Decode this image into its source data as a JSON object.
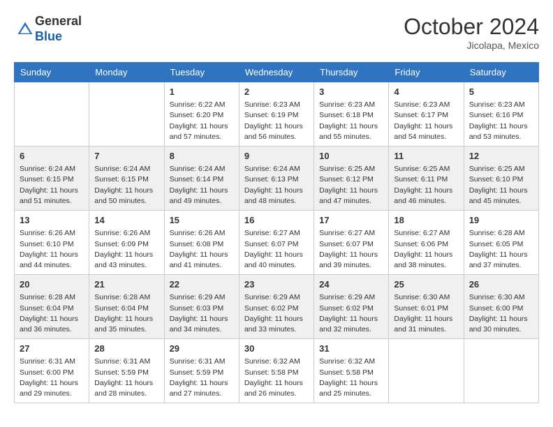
{
  "header": {
    "logo": {
      "line1": "General",
      "line2": "Blue"
    },
    "month": "October 2024",
    "location": "Jicolapa, Mexico"
  },
  "weekdays": [
    "Sunday",
    "Monday",
    "Tuesday",
    "Wednesday",
    "Thursday",
    "Friday",
    "Saturday"
  ],
  "weeks": [
    [
      {
        "day": "",
        "info": ""
      },
      {
        "day": "",
        "info": ""
      },
      {
        "day": "1",
        "info": "Sunrise: 6:22 AM\nSunset: 6:20 PM\nDaylight: 11 hours and 57 minutes."
      },
      {
        "day": "2",
        "info": "Sunrise: 6:23 AM\nSunset: 6:19 PM\nDaylight: 11 hours and 56 minutes."
      },
      {
        "day": "3",
        "info": "Sunrise: 6:23 AM\nSunset: 6:18 PM\nDaylight: 11 hours and 55 minutes."
      },
      {
        "day": "4",
        "info": "Sunrise: 6:23 AM\nSunset: 6:17 PM\nDaylight: 11 hours and 54 minutes."
      },
      {
        "day": "5",
        "info": "Sunrise: 6:23 AM\nSunset: 6:16 PM\nDaylight: 11 hours and 53 minutes."
      }
    ],
    [
      {
        "day": "6",
        "info": "Sunrise: 6:24 AM\nSunset: 6:15 PM\nDaylight: 11 hours and 51 minutes."
      },
      {
        "day": "7",
        "info": "Sunrise: 6:24 AM\nSunset: 6:15 PM\nDaylight: 11 hours and 50 minutes."
      },
      {
        "day": "8",
        "info": "Sunrise: 6:24 AM\nSunset: 6:14 PM\nDaylight: 11 hours and 49 minutes."
      },
      {
        "day": "9",
        "info": "Sunrise: 6:24 AM\nSunset: 6:13 PM\nDaylight: 11 hours and 48 minutes."
      },
      {
        "day": "10",
        "info": "Sunrise: 6:25 AM\nSunset: 6:12 PM\nDaylight: 11 hours and 47 minutes."
      },
      {
        "day": "11",
        "info": "Sunrise: 6:25 AM\nSunset: 6:11 PM\nDaylight: 11 hours and 46 minutes."
      },
      {
        "day": "12",
        "info": "Sunrise: 6:25 AM\nSunset: 6:10 PM\nDaylight: 11 hours and 45 minutes."
      }
    ],
    [
      {
        "day": "13",
        "info": "Sunrise: 6:26 AM\nSunset: 6:10 PM\nDaylight: 11 hours and 44 minutes."
      },
      {
        "day": "14",
        "info": "Sunrise: 6:26 AM\nSunset: 6:09 PM\nDaylight: 11 hours and 43 minutes."
      },
      {
        "day": "15",
        "info": "Sunrise: 6:26 AM\nSunset: 6:08 PM\nDaylight: 11 hours and 41 minutes."
      },
      {
        "day": "16",
        "info": "Sunrise: 6:27 AM\nSunset: 6:07 PM\nDaylight: 11 hours and 40 minutes."
      },
      {
        "day": "17",
        "info": "Sunrise: 6:27 AM\nSunset: 6:07 PM\nDaylight: 11 hours and 39 minutes."
      },
      {
        "day": "18",
        "info": "Sunrise: 6:27 AM\nSunset: 6:06 PM\nDaylight: 11 hours and 38 minutes."
      },
      {
        "day": "19",
        "info": "Sunrise: 6:28 AM\nSunset: 6:05 PM\nDaylight: 11 hours and 37 minutes."
      }
    ],
    [
      {
        "day": "20",
        "info": "Sunrise: 6:28 AM\nSunset: 6:04 PM\nDaylight: 11 hours and 36 minutes."
      },
      {
        "day": "21",
        "info": "Sunrise: 6:28 AM\nSunset: 6:04 PM\nDaylight: 11 hours and 35 minutes."
      },
      {
        "day": "22",
        "info": "Sunrise: 6:29 AM\nSunset: 6:03 PM\nDaylight: 11 hours and 34 minutes."
      },
      {
        "day": "23",
        "info": "Sunrise: 6:29 AM\nSunset: 6:02 PM\nDaylight: 11 hours and 33 minutes."
      },
      {
        "day": "24",
        "info": "Sunrise: 6:29 AM\nSunset: 6:02 PM\nDaylight: 11 hours and 32 minutes."
      },
      {
        "day": "25",
        "info": "Sunrise: 6:30 AM\nSunset: 6:01 PM\nDaylight: 11 hours and 31 minutes."
      },
      {
        "day": "26",
        "info": "Sunrise: 6:30 AM\nSunset: 6:00 PM\nDaylight: 11 hours and 30 minutes."
      }
    ],
    [
      {
        "day": "27",
        "info": "Sunrise: 6:31 AM\nSunset: 6:00 PM\nDaylight: 11 hours and 29 minutes."
      },
      {
        "day": "28",
        "info": "Sunrise: 6:31 AM\nSunset: 5:59 PM\nDaylight: 11 hours and 28 minutes."
      },
      {
        "day": "29",
        "info": "Sunrise: 6:31 AM\nSunset: 5:59 PM\nDaylight: 11 hours and 27 minutes."
      },
      {
        "day": "30",
        "info": "Sunrise: 6:32 AM\nSunset: 5:58 PM\nDaylight: 11 hours and 26 minutes."
      },
      {
        "day": "31",
        "info": "Sunrise: 6:32 AM\nSunset: 5:58 PM\nDaylight: 11 hours and 25 minutes."
      },
      {
        "day": "",
        "info": ""
      },
      {
        "day": "",
        "info": ""
      }
    ]
  ]
}
